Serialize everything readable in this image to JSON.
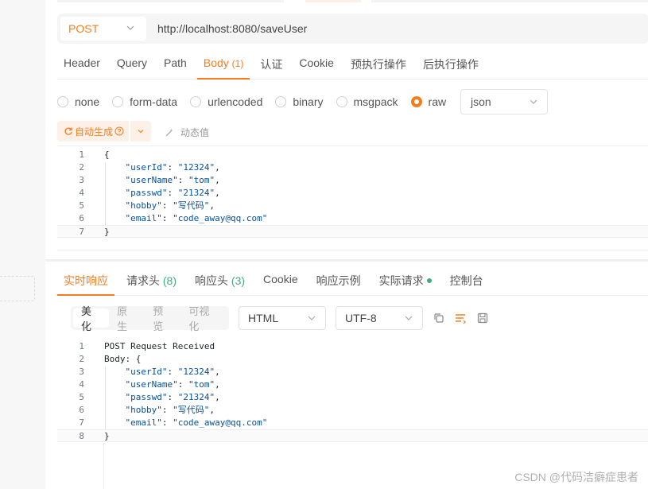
{
  "request": {
    "method": "POST",
    "url": "http://localhost:8080/saveUser",
    "tabs": [
      {
        "label": "Header",
        "count": ""
      },
      {
        "label": "Query",
        "count": ""
      },
      {
        "label": "Path",
        "count": ""
      },
      {
        "label": "Body",
        "count": "(1)"
      },
      {
        "label": "认证",
        "count": ""
      },
      {
        "label": "Cookie",
        "count": ""
      },
      {
        "label": "预执行操作",
        "count": ""
      },
      {
        "label": "后执行操作",
        "count": ""
      }
    ],
    "active_tab": "Body",
    "body_types": [
      "none",
      "form-data",
      "urlencoded",
      "binary",
      "msgpack",
      "raw"
    ],
    "selected_body_type": "raw",
    "format": "json",
    "autogen_label": "自动生成",
    "dynamic_label": "动态值",
    "body_lines": [
      "{",
      "    \"userId\": \"12324\",",
      "    \"userName\": \"tom\",",
      "    \"passwd\": \"21324\",",
      "    \"hobby\": \"写代码\",",
      "    \"email\": \"code_away@qq.com\"",
      "}"
    ]
  },
  "response": {
    "tabs": [
      {
        "label": "实时响应",
        "count": ""
      },
      {
        "label": "请求头",
        "count": "(8)"
      },
      {
        "label": "响应头",
        "count": "(3)"
      },
      {
        "label": "Cookie",
        "count": ""
      },
      {
        "label": "响应示例",
        "count": ""
      },
      {
        "label": "实际请求",
        "count": ""
      },
      {
        "label": "控制台",
        "count": ""
      }
    ],
    "active_tab": "实时响应",
    "view_modes": [
      "美化",
      "原生",
      "预览",
      "可视化"
    ],
    "active_view": "美化",
    "content_type": "HTML",
    "encoding": "UTF-8",
    "lines": [
      "POST Request Received",
      "Body: {",
      "    \"userId\": \"12324\",",
      "    \"userName\": \"tom\",",
      "    \"passwd\": \"21324\",",
      "    \"hobby\": \"写代码\",",
      "    \"email\": \"code_away@qq.com\"",
      "}"
    ]
  },
  "watermark": "CSDN @代码洁癖症患者",
  "colors": {
    "accent": "#f97c1c",
    "success": "#3eaf7c",
    "string": "#0451a5"
  }
}
